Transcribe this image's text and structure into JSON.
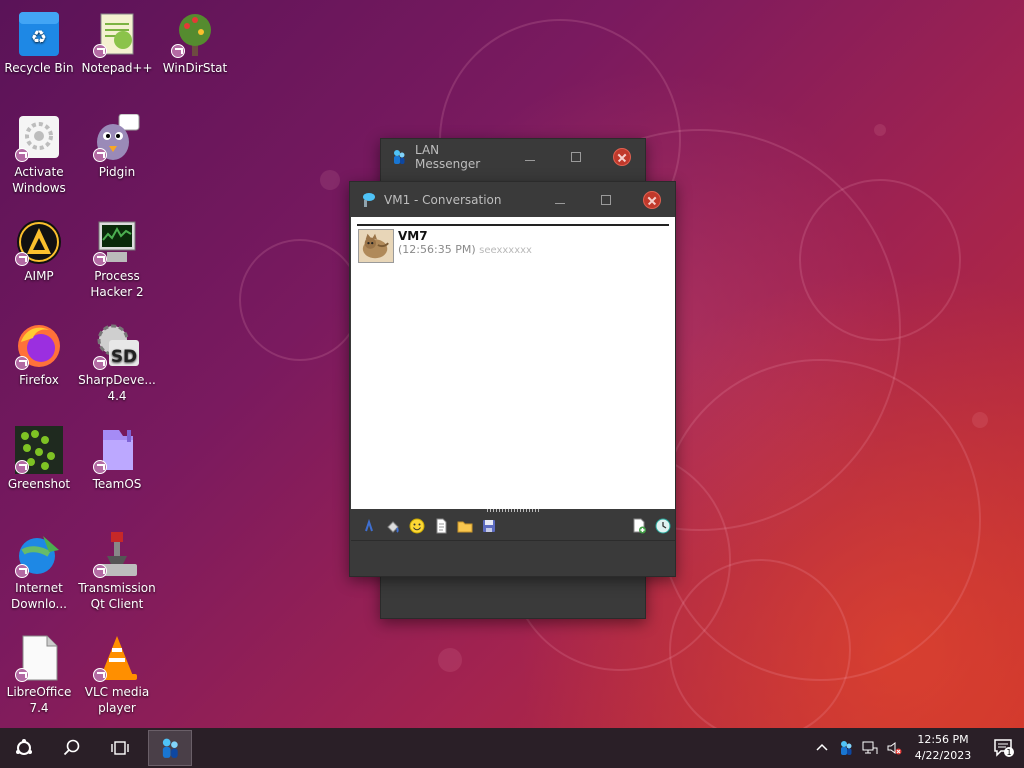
{
  "desktop": {
    "icons": [
      {
        "label": "Recycle Bin",
        "icon": "recycle-bin-icon"
      },
      {
        "label": "Notepad++",
        "icon": "notepadpp-icon"
      },
      {
        "label": "WinDirStat",
        "icon": "windirstat-icon"
      },
      {
        "label": "Activate Windows",
        "icon": "activate-windows-icon"
      },
      {
        "label": "Pidgin",
        "icon": "pidgin-icon"
      },
      {
        "label": "AIMP",
        "icon": "aimp-icon"
      },
      {
        "label": "Process Hacker 2",
        "icon": "process-hacker-icon"
      },
      {
        "label": "Firefox",
        "icon": "firefox-icon"
      },
      {
        "label": "SharpDeve... 4.4",
        "icon": "sharpdevelop-icon"
      },
      {
        "label": "Greenshot",
        "icon": "greenshot-icon"
      },
      {
        "label": "TeamOS",
        "icon": "teamos-folder-icon"
      },
      {
        "label": "Internet Downlo...",
        "icon": "internet-download-manager-icon"
      },
      {
        "label": "Transmission Qt Client",
        "icon": "transmission-icon"
      },
      {
        "label": "LibreOffice 7.4",
        "icon": "libreoffice-icon"
      },
      {
        "label": "VLC media player",
        "icon": "vlc-icon"
      }
    ]
  },
  "lan_messenger": {
    "title": "LAN Messenger"
  },
  "conversation": {
    "title": "VM1 - Conversation",
    "message": {
      "sender": "VM7",
      "time": "(12:56:35 PM)",
      "text": "seexxxxxx"
    }
  },
  "taskbar": {
    "time": "12:56 PM",
    "date": "4/22/2023",
    "notification_count": "1"
  },
  "colors": {
    "close_red": "#c0392b",
    "window_dark": "#3a3a3a",
    "taskbar": "#2a1f27"
  }
}
